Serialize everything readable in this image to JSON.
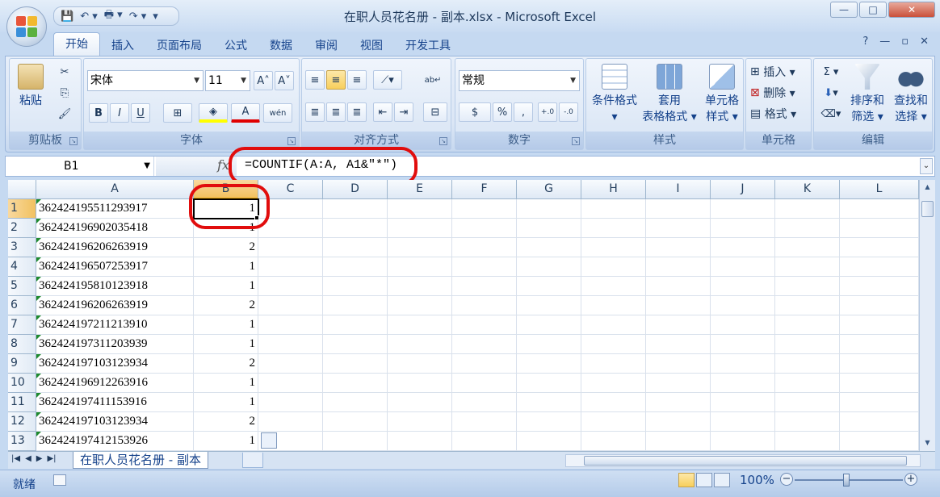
{
  "window": {
    "title": "在职人员花名册 - 副本.xlsx - Microsoft Excel",
    "minimize": "—",
    "maximize": "□",
    "close": "✕"
  },
  "qat": {
    "save": "💾",
    "undo": "↶ ▾",
    "print": "🖶 ▾",
    "redo": "↷ ▾",
    "customize": "▾"
  },
  "tabs": [
    "开始",
    "插入",
    "页面布局",
    "公式",
    "数据",
    "审阅",
    "视图",
    "开发工具"
  ],
  "tab_right": {
    "help": "?",
    "min": "—",
    "restore": "▫",
    "close": "✕"
  },
  "ribbon": {
    "clipboard": {
      "paste": "粘贴",
      "label": "剪贴板"
    },
    "font": {
      "name": "宋体",
      "size": "11",
      "grow": "A˄",
      "shrink": "A˅",
      "bold": "B",
      "italic": "I",
      "underline": "U",
      "border": "⊞",
      "fill": "◈",
      "color": "A",
      "phonetic": "wén",
      "label": "字体"
    },
    "alignment": {
      "wrap": "ab↵",
      "merge": "⊟",
      "label": "对齐方式"
    },
    "number": {
      "format": "常规",
      "currency": "$",
      "percent": "%",
      "comma": ",",
      "inc": "+.0",
      "dec": "-.0",
      "label": "数字"
    },
    "styles": {
      "conditional": [
        "条件格式",
        "▾"
      ],
      "table": [
        "套用",
        "表格格式 ▾"
      ],
      "cell": [
        "单元格",
        "样式 ▾"
      ],
      "label": "样式"
    },
    "cells": {
      "insert": "插入 ▾",
      "delete": "删除 ▾",
      "format": "格式 ▾",
      "label": "单元格"
    },
    "editing": {
      "sum": "Σ ▾",
      "fill": "▾",
      "clear": "▾",
      "sort": [
        "排序和",
        "筛选 ▾"
      ],
      "find": [
        "查找和",
        "选择 ▾"
      ],
      "label": "编辑"
    }
  },
  "formula_bar": {
    "name_box": "B1",
    "fx": "fx",
    "formula": "=COUNTIF(A:A, A1&\"*\")"
  },
  "columns": [
    "A",
    "B",
    "C",
    "D",
    "E",
    "F",
    "G",
    "H",
    "I",
    "J",
    "K",
    "L"
  ],
  "rows": [
    {
      "n": "1",
      "a": "362424195511293917",
      "b": "1"
    },
    {
      "n": "2",
      "a": "362424196902035418",
      "b": "1"
    },
    {
      "n": "3",
      "a": "362424196206263919",
      "b": "2"
    },
    {
      "n": "4",
      "a": "362424196507253917",
      "b": "1"
    },
    {
      "n": "5",
      "a": "362424195810123918",
      "b": "1"
    },
    {
      "n": "6",
      "a": "362424196206263919",
      "b": "2"
    },
    {
      "n": "7",
      "a": "362424197211213910",
      "b": "1"
    },
    {
      "n": "8",
      "a": "362424197311203939",
      "b": "1"
    },
    {
      "n": "9",
      "a": "362424197103123934",
      "b": "2"
    },
    {
      "n": "10",
      "a": "362424196912263916",
      "b": "1"
    },
    {
      "n": "11",
      "a": "362424197411153916",
      "b": "1"
    },
    {
      "n": "12",
      "a": "362424197103123934",
      "b": "2"
    },
    {
      "n": "13",
      "a": "362424197412153926",
      "b": "1"
    }
  ],
  "sheet_nav": [
    "|◀",
    "◀",
    "▶",
    "▶|"
  ],
  "sheet_tab": "在职人员花名册 - 副本",
  "status": {
    "ready": "就绪",
    "zoom": "100%",
    "zoom_minus": "−",
    "zoom_plus": "+"
  },
  "colors": {
    "callout": "#e10d0d",
    "active_tab": "#fdfeff",
    "selection": "#000000"
  }
}
